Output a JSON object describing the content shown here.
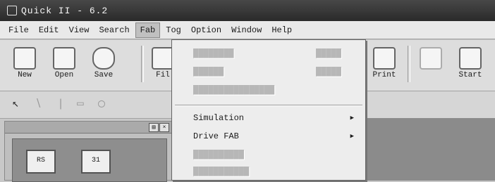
{
  "window": {
    "title": "Quick II - 6.2"
  },
  "menubar": {
    "items": [
      {
        "label": "File"
      },
      {
        "label": "Edit"
      },
      {
        "label": "View"
      },
      {
        "label": "Search"
      },
      {
        "label": "Fab"
      },
      {
        "label": "Tog"
      },
      {
        "label": "Option"
      },
      {
        "label": "Window"
      },
      {
        "label": "Help"
      }
    ]
  },
  "toolbar": {
    "buttons": [
      {
        "label": "New",
        "icon": "new-document-icon"
      },
      {
        "label": "Open",
        "icon": "open-folder-icon"
      },
      {
        "label": "Save",
        "icon": "save-icon"
      },
      {
        "label": "Fil",
        "icon": "fabric-icon"
      },
      {
        "label": "Print",
        "icon": "printer-icon"
      },
      {
        "label": "",
        "icon": "pattern-icon"
      },
      {
        "label": "Start",
        "icon": "start-icon"
      }
    ]
  },
  "fab_menu": {
    "items": [
      {
        "label": "",
        "shortcut": "",
        "enabled": false
      },
      {
        "label": "",
        "shortcut": "",
        "enabled": false
      },
      {
        "label": "",
        "shortcut": "",
        "enabled": false
      },
      {
        "label": "Simulation",
        "has_submenu": true,
        "enabled": true
      },
      {
        "label": "Drive FAB",
        "has_submenu": true,
        "enabled": true
      },
      {
        "label": "",
        "enabled": false
      },
      {
        "label": "",
        "enabled": false
      }
    ]
  },
  "left_panel": {
    "chips": [
      {
        "label": "RS"
      },
      {
        "label": "31"
      }
    ]
  }
}
